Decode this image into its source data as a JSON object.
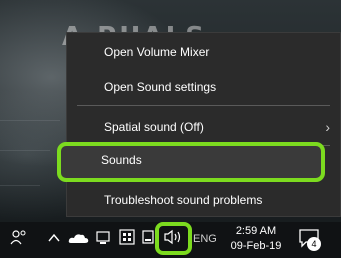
{
  "watermark": {
    "text": "A PUALS"
  },
  "context_menu": {
    "items": [
      {
        "label": "Open Volume Mixer"
      },
      {
        "label": "Open Sound settings"
      },
      {
        "label": "Spatial sound (Off)",
        "has_submenu": true
      },
      {
        "label": "Sounds",
        "highlighted": true
      },
      {
        "label": "Troubleshoot sound problems"
      }
    ]
  },
  "taskbar": {
    "tray_icons": [
      "people-icon",
      "show-hidden-icons-chevron",
      "onedrive-icon",
      "device-icon",
      "security-icon",
      "network-icon",
      "volume-icon"
    ],
    "language": "ENG",
    "clock": {
      "time": "2:59 AM",
      "date": "09-Feb-19"
    },
    "notifications": {
      "count": "4"
    }
  },
  "colors": {
    "highlight": "#7cdb1f",
    "menu_background": "#2b2b2b",
    "taskbar_background": "#101214"
  }
}
